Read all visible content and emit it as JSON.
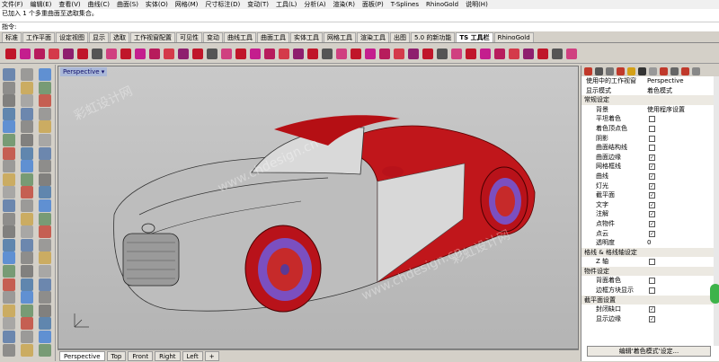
{
  "menubar": [
    "文件(F)",
    "编辑(E)",
    "查看(V)",
    "曲线(C)",
    "曲面(S)",
    "实体(O)",
    "网格(M)",
    "尺寸标注(D)",
    "变动(T)",
    "工具(L)",
    "分析(A)",
    "渲染(R)",
    "面板(P)",
    "T-Splines",
    "RhinoGold",
    "说明(H)"
  ],
  "command": {
    "history": "已加入 1 个多重曲面至选取集合。",
    "prompt": "指令: "
  },
  "tabs": [
    "标准",
    "工作平面",
    "设定视图",
    "显示",
    "选取",
    "工作视窗配置",
    "可见性",
    "变动",
    "曲线工具",
    "曲面工具",
    "实体工具",
    "网格工具",
    "渲染工具",
    "出图",
    "5.0 的新功能",
    "TS 工具栏",
    "RhinoGold"
  ],
  "active_tab": "TS 工具栏",
  "viewport": {
    "title": "Perspective",
    "tabs": [
      "Perspective",
      "Top",
      "Front",
      "Right",
      "Left"
    ],
    "active_tab": "Perspective",
    "watermarks": [
      "www.chdesign.cn",
      "彩虹设计网"
    ]
  },
  "panel": {
    "rows": [
      {
        "type": "kv",
        "label": "使用中的工作视窗",
        "value": "Perspective"
      },
      {
        "type": "kv",
        "label": "显示模式",
        "value": "着色模式"
      },
      {
        "type": "section",
        "label": "常规设定"
      },
      {
        "type": "kv",
        "label": "背景",
        "value": "使用程序设置",
        "indent": true
      },
      {
        "type": "check",
        "label": "平坦着色",
        "checked": false
      },
      {
        "type": "check",
        "label": "着色顶点色",
        "checked": false
      },
      {
        "type": "check",
        "label": "阴影",
        "checked": false
      },
      {
        "type": "check",
        "label": "曲面结构线",
        "checked": false
      },
      {
        "type": "check",
        "label": "曲面边缘",
        "checked": true
      },
      {
        "type": "check",
        "label": "网格框线",
        "checked": true
      },
      {
        "type": "check",
        "label": "曲线",
        "checked": true
      },
      {
        "type": "check",
        "label": "灯光",
        "checked": true
      },
      {
        "type": "check",
        "label": "截平面",
        "checked": true
      },
      {
        "type": "check",
        "label": "文字",
        "checked": true
      },
      {
        "type": "check",
        "label": "注解",
        "checked": true
      },
      {
        "type": "check",
        "label": "点物件",
        "checked": true
      },
      {
        "type": "check",
        "label": "点云",
        "checked": true
      },
      {
        "type": "kv",
        "label": "透明度",
        "value": "0",
        "indent": true
      },
      {
        "type": "section",
        "label": "格线 & 格线轴设定"
      },
      {
        "type": "check",
        "label": "Z 轴",
        "checked": false
      },
      {
        "type": "section",
        "label": "物件设定"
      },
      {
        "type": "check",
        "label": "背面着色",
        "checked": false
      },
      {
        "type": "check",
        "label": "边框方块显示",
        "checked": false
      },
      {
        "type": "section",
        "label": "截平面设置"
      },
      {
        "type": "check",
        "label": "封闭缺口",
        "checked": true
      },
      {
        "type": "check",
        "label": "显示边缘",
        "checked": true
      }
    ],
    "button": "编辑'着色模式'设定..."
  }
}
